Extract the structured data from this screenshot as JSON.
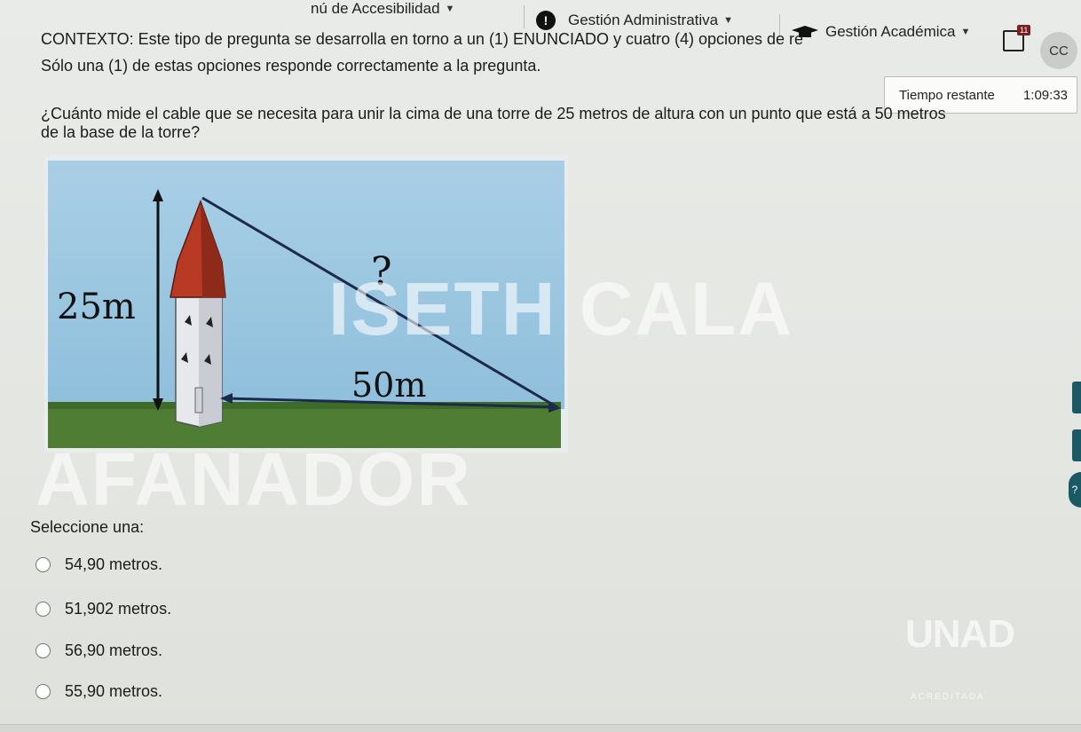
{
  "nav": {
    "accessibility": "nú de Accesibilidad",
    "admin": "Gestión Administrativa",
    "academic": "Gestión Académica",
    "messages_badge": "11",
    "avatar": "CC",
    "icons": [
      "chevron-down-icon",
      "alert-icon",
      "graduation-cap-icon",
      "message-icon"
    ]
  },
  "timer": {
    "label": "Tiempo restante",
    "value": "1:09:33"
  },
  "context": {
    "line1": "CONTEXTO: Este tipo de pregunta se desarrolla en torno a un (1) ENUNCIADO y cuatro (4) opciones de re",
    "line2": "Sólo una (1) de estas opciones responde correctamente a la pregunta."
  },
  "question": {
    "line1": "¿Cuánto mide el cable que se necesita para unir la cima de una torre de 25 metros de altura con un punto que está a 50 metros",
    "line2": "de la base de la torre?"
  },
  "figure": {
    "height_label": "25m",
    "base_label": "50m",
    "unknown_label": "?"
  },
  "watermark": {
    "name": "ISETH CALA",
    "word": "AFANADOR"
  },
  "prompt": "Seleccione una:",
  "options": [
    {
      "label": "54,90 metros."
    },
    {
      "label": "51,902 metros."
    },
    {
      "label": "56,90 metros."
    },
    {
      "label": "55,90 metros."
    }
  ],
  "logo": {
    "text": "UNAD",
    "sub": "ACREDITADA"
  },
  "help_icon": "?"
}
